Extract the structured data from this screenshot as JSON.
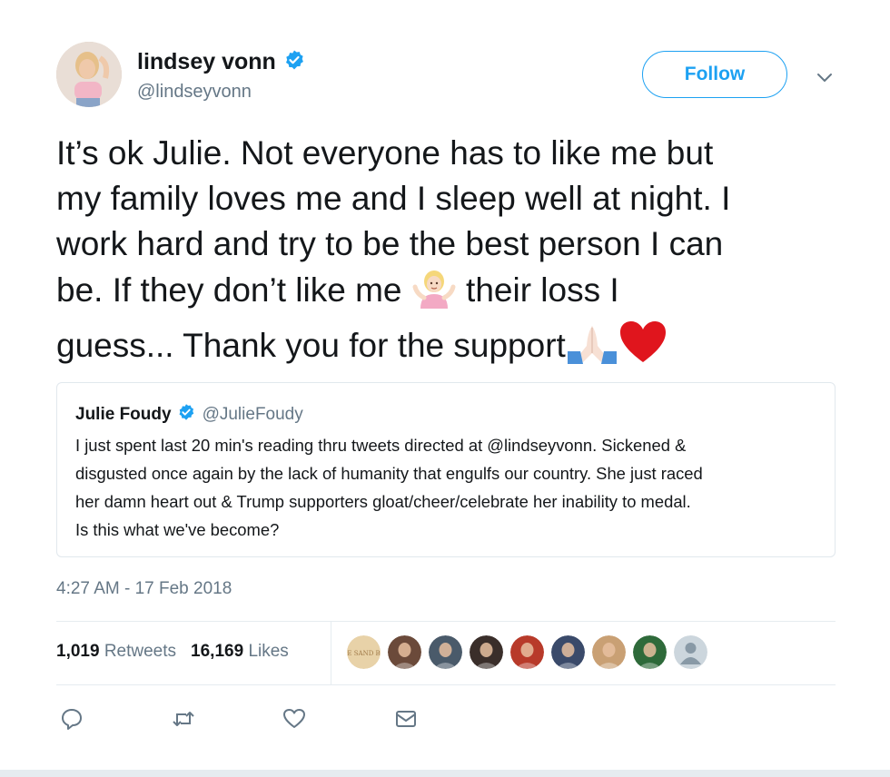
{
  "author": {
    "display_name": "lindsey vonn",
    "handle": "@lindseyvonn",
    "verified": true
  },
  "follow_button": {
    "label": "Follow"
  },
  "tweet": {
    "line1": "It’s ok Julie. Not everyone has to like me but",
    "line2": "my family loves me and I sleep well at night. I",
    "line3": "work hard and try to be the best person I can",
    "line4a": "be. If they don’t like me ",
    "line4b": " their loss I",
    "line5": "guess... Thank you for the support",
    "emojis": [
      "person-shrugging-emoji",
      "folded-hands-emoji",
      "red-heart-emoji"
    ]
  },
  "quoted_tweet": {
    "display_name": "Julie Foudy",
    "handle": "@JulieFoudy",
    "verified": true,
    "lines": [
      "I just spent last 20 min's reading thru tweets directed at @lindseyvonn. Sickened &",
      "disgusted once again by the lack of humanity that engulfs our country. She just raced",
      "her damn heart out & Trump supporters gloat/cheer/celebrate her inability to medal.",
      "Is this what we've become?"
    ]
  },
  "timestamp": "4:27 AM - 17 Feb 2018",
  "stats": {
    "retweets_count": "1,019",
    "retweets_label": "Retweets",
    "likes_count": "16,169",
    "likes_label": "Likes"
  },
  "likers": [
    {
      "name": "liker-avatar-the-sand-box",
      "color": "#e8d2a8",
      "text": "THE SAND BOX"
    },
    {
      "name": "liker-avatar-2",
      "color": "#6b4a3a"
    },
    {
      "name": "liker-avatar-3",
      "color": "#4a5a6a"
    },
    {
      "name": "liker-avatar-4",
      "color": "#3a2e2a"
    },
    {
      "name": "liker-avatar-5",
      "color": "#b83a2a"
    },
    {
      "name": "liker-avatar-6",
      "color": "#3a4a6a"
    },
    {
      "name": "liker-avatar-7",
      "color": "#c9a074"
    },
    {
      "name": "liker-avatar-8",
      "color": "#2e6a3a"
    },
    {
      "name": "liker-avatar-default",
      "color": "#ccd6dd"
    }
  ],
  "colors": {
    "accent": "#1da1f2",
    "text": "#14171a",
    "secondary_text": "#657786",
    "border": "#e1e8ed"
  },
  "icons": [
    "verified-badge-icon",
    "chevron-down-icon",
    "reply-icon",
    "retweet-icon",
    "like-icon",
    "direct-message-icon"
  ]
}
